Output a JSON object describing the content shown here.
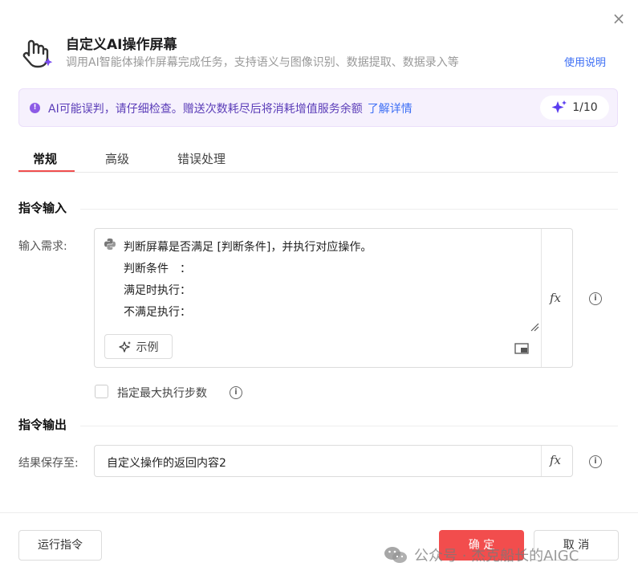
{
  "dialog": {
    "close_glyph": "×",
    "title": "自定义AI操作屏幕",
    "subtitle": "调用AI智能体操作屏幕完成任务，支持语义与图像识别、数据提取、数据录入等",
    "help_link": "使用说明"
  },
  "notice": {
    "icon_glyph": "!",
    "text": "AI可能误判，请仔细检查。赠送次数耗尽后将消耗增值服务余额",
    "link": "了解详情",
    "quota": "1/10"
  },
  "tabs": [
    {
      "label": "常规",
      "active": true
    },
    {
      "label": "高级",
      "active": false
    },
    {
      "label": "错误处理",
      "active": false
    }
  ],
  "instruction_input": {
    "section_title": "指令输入",
    "field_label": "输入需求:",
    "lines": [
      "判断屏幕是否满足 [判断条件]，并执行对应操作。",
      "判断条件　：",
      "满足时执行：",
      "不满足执行："
    ],
    "example_button": "示例",
    "fx_label": "fx",
    "info_glyph": "i"
  },
  "max_steps": {
    "label": "指定最大执行步数",
    "checked": false
  },
  "instruction_output": {
    "section_title": "指令输出",
    "field_label": "结果保存至:",
    "value": "自定义操作的返回内容2",
    "fx_label": "fx"
  },
  "footer": {
    "run_button": "运行指令",
    "ok_button": "确 定",
    "cancel_button": "取 消"
  },
  "watermark": {
    "text": "公众号 · 杰克船长的AIGC"
  },
  "colors": {
    "accent": "#f24d4d",
    "link": "#3d6ff5",
    "notice_bg": "#f6f1fd",
    "notice_text": "#5b3db8"
  }
}
